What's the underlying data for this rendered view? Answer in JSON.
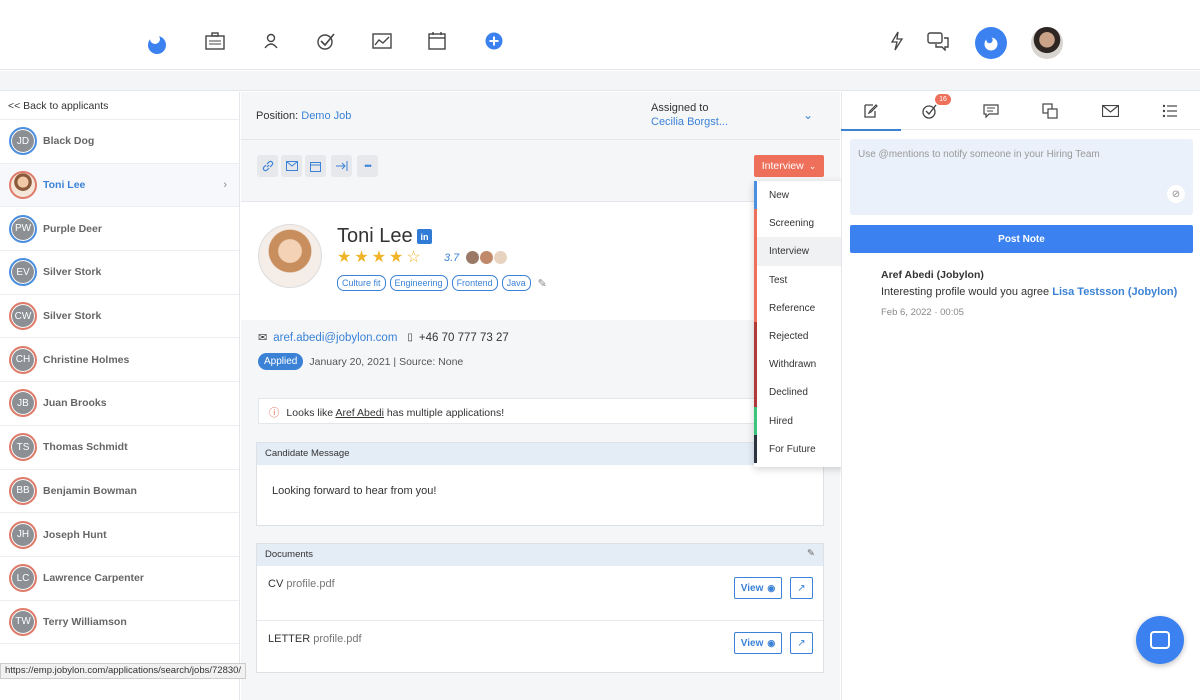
{
  "topbar": {
    "icons": [
      "logo-icon",
      "briefcase-icon",
      "person-icon",
      "check-icon",
      "chart-icon",
      "calendar-icon",
      "add-icon",
      "bolt-icon",
      "chat-icon",
      "org-avatar",
      "user-avatar"
    ]
  },
  "sidebar": {
    "back_label": "<< Back to applicants",
    "applicants": [
      {
        "initials": "JD",
        "name": "Black Dog"
      },
      {
        "initials": "",
        "name": "Toni Lee"
      },
      {
        "initials": "PW",
        "name": "Purple Deer"
      },
      {
        "initials": "EV",
        "name": "Silver Stork"
      },
      {
        "initials": "CW",
        "name": "Silver Stork"
      },
      {
        "initials": "CH",
        "name": "Christine Holmes"
      },
      {
        "initials": "JB",
        "name": "Juan Brooks"
      },
      {
        "initials": "TS",
        "name": "Thomas Schmidt"
      },
      {
        "initials": "BB",
        "name": "Benjamin Bowman"
      },
      {
        "initials": "JH",
        "name": "Joseph Hunt"
      },
      {
        "initials": "LC",
        "name": "Lawrence Carpenter"
      },
      {
        "initials": "TW",
        "name": "Terry Williamson"
      }
    ]
  },
  "main": {
    "position_label": "Position: ",
    "position_value": "Demo Job",
    "assigned_label": "Assigned to",
    "assigned_value": "Cecilia Borgst...",
    "status_label": "Interview",
    "candidate": {
      "name": "Toni Lee",
      "linkedin": "in",
      "rating": "3.7",
      "stars": 3.7,
      "tags": [
        "Culture fit",
        "Engineering",
        "Frontend",
        "Java"
      ],
      "email": "aref.abedi@jobylon.com",
      "phone": "+46 70 777 73 27",
      "status_badge": "Applied",
      "applied_info": "January 20, 2021 | Source: None"
    },
    "notice": {
      "prefix": "Looks like ",
      "link": "Aref Abedi",
      "suffix": " has multiple applications!"
    },
    "message_card": {
      "title": "Candidate Message",
      "body": "Looking forward to hear from you!"
    },
    "documents_card": {
      "title": "Documents",
      "view_label": "View",
      "docs": [
        {
          "type": "CV",
          "file": "profile.pdf"
        },
        {
          "type": "LETTER",
          "file": "profile.pdf"
        }
      ]
    }
  },
  "status_dropdown": {
    "items": [
      {
        "label": "New",
        "color": "#4a8fe0"
      },
      {
        "label": "Screening",
        "color": "#ee6f5a"
      },
      {
        "label": "Interview",
        "color": "#ee6f5a"
      },
      {
        "label": "Test",
        "color": "#ee6f5a"
      },
      {
        "label": "Reference",
        "color": "#ee6f5a"
      },
      {
        "label": "Rejected",
        "color": "#b03a3a"
      },
      {
        "label": "Withdrawn",
        "color": "#b03a3a"
      },
      {
        "label": "Declined",
        "color": "#b03a3a"
      },
      {
        "label": "Hired",
        "color": "#3cc47c"
      },
      {
        "label": "For Future",
        "color": "#2c3440"
      }
    ]
  },
  "right_panel": {
    "badge_count": "16",
    "note_placeholder": "Use @mentions to notify someone in your Hiring Team",
    "post_button": "Post Note",
    "comment": {
      "author": "Aref Abedi (Jobylon)",
      "text": "Interesting profile would you agree ",
      "mention": "Lisa Testsson (Jobylon)",
      "time": "Feb 6, 2022 · 00:05"
    }
  },
  "status_bar_url": "https://emp.jobylon.com/applications/search/jobs/72830/",
  "colors": {
    "accent": "#3b82d6",
    "status": "#ee6f5a"
  }
}
